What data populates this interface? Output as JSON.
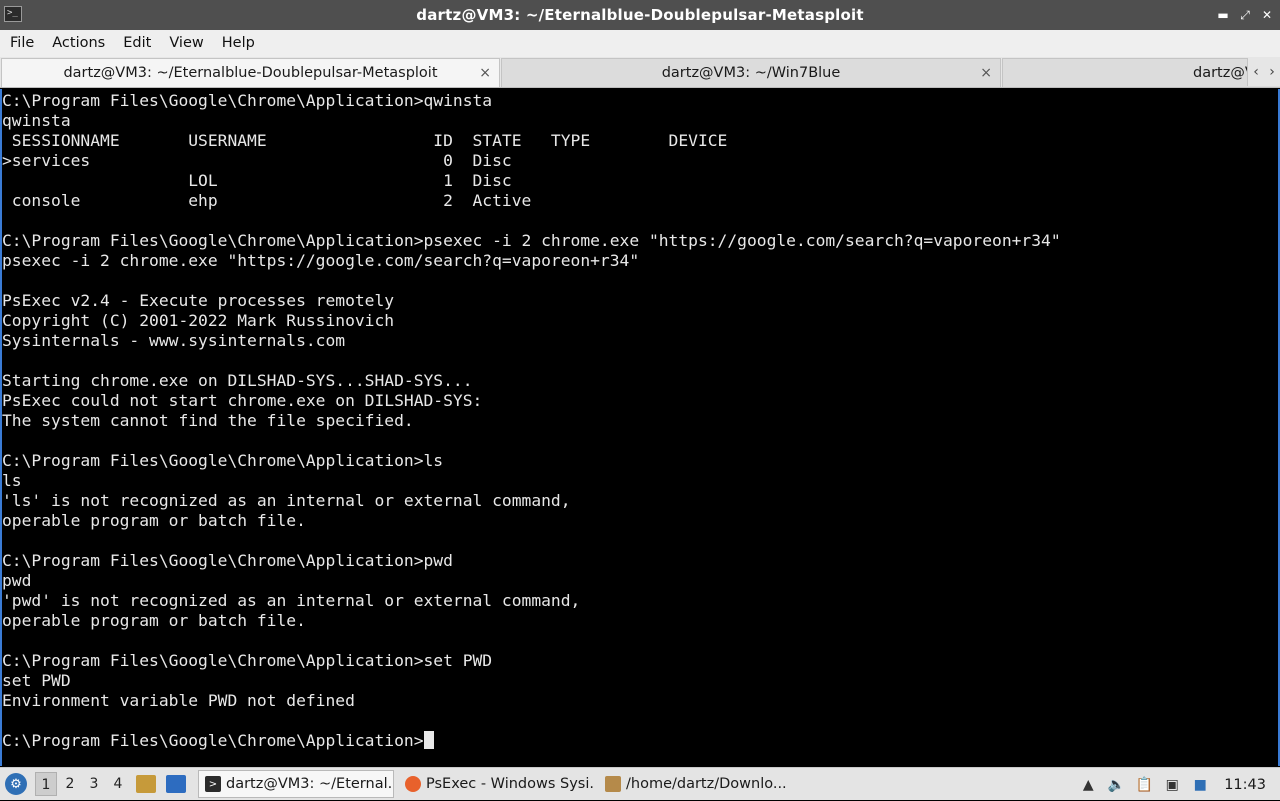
{
  "window": {
    "title": "dartz@VM3: ~/Eternalblue-Doublepulsar-Metasploit",
    "app_icon": "terminal-icon",
    "controls": [
      "minimize-icon",
      "maximize-icon",
      "close-icon"
    ]
  },
  "menu": {
    "file": "File",
    "actions": "Actions",
    "edit": "Edit",
    "view": "View",
    "help": "Help"
  },
  "tabs": [
    {
      "label": "dartz@VM3: ~/Eternalblue-Doublepulsar-Metasploit",
      "active": true
    },
    {
      "label": "dartz@VM3: ~/Win7Blue",
      "active": false
    },
    {
      "label": "dartz@V",
      "active": false
    }
  ],
  "tab_close_glyph": "×",
  "terminal": {
    "lines": [
      "C:\\Program Files\\Google\\Chrome\\Application>qwinsta",
      "qwinsta",
      " SESSIONNAME       USERNAME                 ID  STATE   TYPE        DEVICE",
      ">services                                    0  Disc",
      "                   LOL                       1  Disc",
      " console           ehp                       2  Active",
      "",
      "C:\\Program Files\\Google\\Chrome\\Application>psexec -i 2 chrome.exe \"https://google.com/search?q=vaporeon+r34\"",
      "psexec -i 2 chrome.exe \"https://google.com/search?q=vaporeon+r34\"",
      "",
      "PsExec v2.4 - Execute processes remotely",
      "Copyright (C) 2001-2022 Mark Russinovich",
      "Sysinternals - www.sysinternals.com",
      "",
      "Starting chrome.exe on DILSHAD-SYS...SHAD-SYS...",
      "PsExec could not start chrome.exe on DILSHAD-SYS:",
      "The system cannot find the file specified.",
      "",
      "C:\\Program Files\\Google\\Chrome\\Application>ls",
      "ls",
      "'ls' is not recognized as an internal or external command,",
      "operable program or batch file.",
      "",
      "C:\\Program Files\\Google\\Chrome\\Application>pwd",
      "pwd",
      "'pwd' is not recognized as an internal or external command,",
      "operable program or batch file.",
      "",
      "C:\\Program Files\\Google\\Chrome\\Application>set PWD",
      "set PWD",
      "Environment variable PWD not defined",
      ""
    ],
    "prompt": "C:\\Program Files\\Google\\Chrome\\Application>"
  },
  "taskbar": {
    "workspaces": [
      "1",
      "2",
      "3",
      "4"
    ],
    "active_workspace": "1",
    "tasks": [
      {
        "label": "dartz@VM3: ~/Eternal...",
        "icon": "terminal-icon",
        "color": "#2b2b2b",
        "active": true
      },
      {
        "label": "PsExec - Windows Sysi...",
        "icon": "firefox-icon",
        "color": "#e8612c",
        "active": false
      },
      {
        "label": "/home/dartz/Downlo...",
        "icon": "archive-icon",
        "color": "#b58a4a",
        "active": false
      }
    ],
    "clock": "11:43"
  }
}
